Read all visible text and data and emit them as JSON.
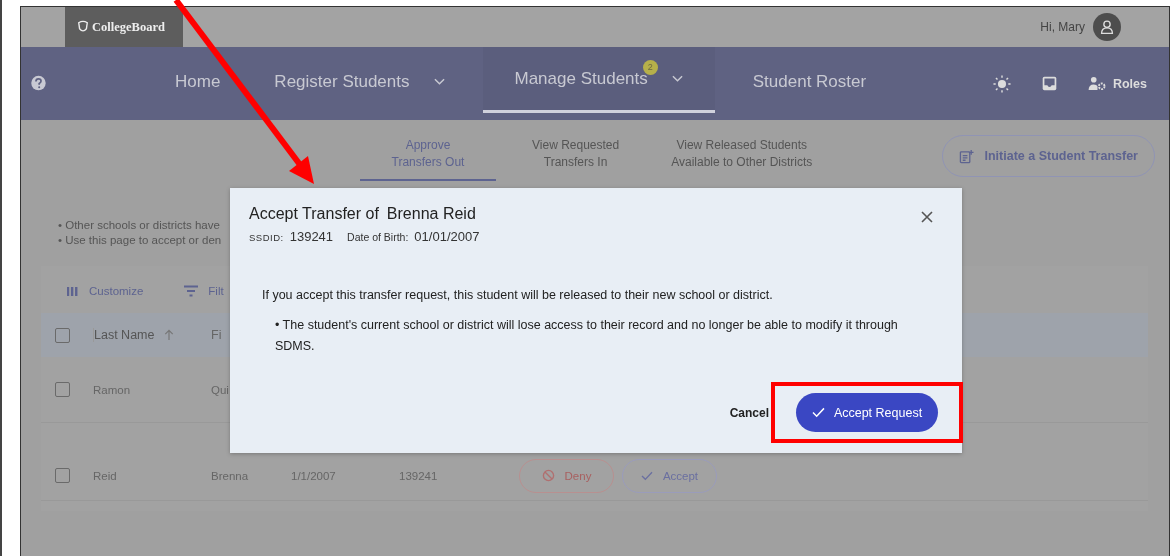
{
  "header": {
    "logo": "CollegeBoard",
    "greeting": "Hi, Mary"
  },
  "nav": {
    "items": [
      {
        "label": "Home",
        "selected": false,
        "dropdown": false
      },
      {
        "label": "Register Students",
        "selected": false,
        "dropdown": true
      },
      {
        "label": "Manage Students",
        "selected": true,
        "dropdown": true,
        "badge": "2"
      },
      {
        "label": "Student Roster",
        "selected": false,
        "dropdown": false
      }
    ],
    "roles": "Roles"
  },
  "subtabs": [
    {
      "label": "Approve\nTransfers Out",
      "selected": true
    },
    {
      "label": "View Requested\nTransfers In",
      "selected": false
    },
    {
      "label": "View Released Students\nAvailable to Other Districts",
      "selected": false
    }
  ],
  "initiate_button": "Initiate a Student Transfer",
  "notes": [
    "• Other schools or districts have",
    "• Use this page to accept or den"
  ],
  "table": {
    "customize": "Customize",
    "filter": "Filt",
    "header_checked": false,
    "columns": [
      {
        "label": "Last Name",
        "sorted": true
      },
      {
        "label": "Fi",
        "sorted": false
      }
    ],
    "rows": [
      {
        "checked": false,
        "cells": [
          "Ramon",
          "Qui"
        ],
        "actions": []
      },
      {
        "checked": false,
        "cells": [
          "Reid",
          "Brenna",
          "1/1/2007",
          "139241"
        ],
        "actions": [
          {
            "kind": "deny",
            "label": "Deny"
          },
          {
            "kind": "accept",
            "label": "Accept"
          }
        ]
      }
    ]
  },
  "dialog": {
    "title": "Accept Transfer of",
    "student": "Brenna Reid",
    "ssdid_label": "SSDID:",
    "ssdid": "139241",
    "dob_label": "Date of Birth:",
    "dob": "01/01/2007",
    "message": "If you accept this transfer request, this student will be released to their new school or district.",
    "bullets": [
      "• The student's current school or district will lose access to their record and no longer be able to modify it through SDMS."
    ],
    "cancel": "Cancel",
    "confirm": "Accept Request"
  },
  "annotations": {
    "arrow": true,
    "highlight": true
  }
}
